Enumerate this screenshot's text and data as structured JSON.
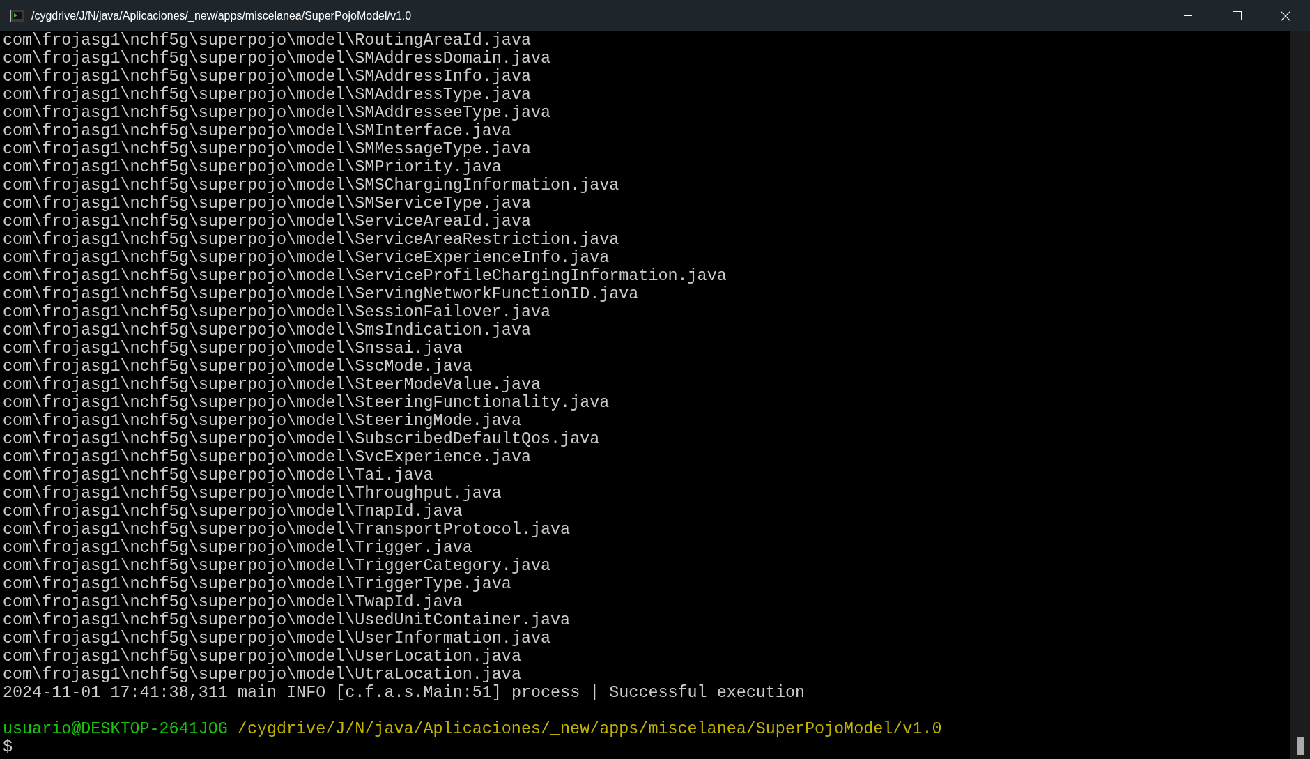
{
  "window": {
    "title": "/cygdrive/J/N/java/Aplicaciones/_new/apps/miscelanea/SuperPojoModel/v1.0"
  },
  "terminal": {
    "lines": [
      "com\\frojasg1\\nchf5g\\superpojo\\model\\RoutingAreaId.java",
      "com\\frojasg1\\nchf5g\\superpojo\\model\\SMAddressDomain.java",
      "com\\frojasg1\\nchf5g\\superpojo\\model\\SMAddressInfo.java",
      "com\\frojasg1\\nchf5g\\superpojo\\model\\SMAddressType.java",
      "com\\frojasg1\\nchf5g\\superpojo\\model\\SMAddresseeType.java",
      "com\\frojasg1\\nchf5g\\superpojo\\model\\SMInterface.java",
      "com\\frojasg1\\nchf5g\\superpojo\\model\\SMMessageType.java",
      "com\\frojasg1\\nchf5g\\superpojo\\model\\SMPriority.java",
      "com\\frojasg1\\nchf5g\\superpojo\\model\\SMSChargingInformation.java",
      "com\\frojasg1\\nchf5g\\superpojo\\model\\SMServiceType.java",
      "com\\frojasg1\\nchf5g\\superpojo\\model\\ServiceAreaId.java",
      "com\\frojasg1\\nchf5g\\superpojo\\model\\ServiceAreaRestriction.java",
      "com\\frojasg1\\nchf5g\\superpojo\\model\\ServiceExperienceInfo.java",
      "com\\frojasg1\\nchf5g\\superpojo\\model\\ServiceProfileChargingInformation.java",
      "com\\frojasg1\\nchf5g\\superpojo\\model\\ServingNetworkFunctionID.java",
      "com\\frojasg1\\nchf5g\\superpojo\\model\\SessionFailover.java",
      "com\\frojasg1\\nchf5g\\superpojo\\model\\SmsIndication.java",
      "com\\frojasg1\\nchf5g\\superpojo\\model\\Snssai.java",
      "com\\frojasg1\\nchf5g\\superpojo\\model\\SscMode.java",
      "com\\frojasg1\\nchf5g\\superpojo\\model\\SteerModeValue.java",
      "com\\frojasg1\\nchf5g\\superpojo\\model\\SteeringFunctionality.java",
      "com\\frojasg1\\nchf5g\\superpojo\\model\\SteeringMode.java",
      "com\\frojasg1\\nchf5g\\superpojo\\model\\SubscribedDefaultQos.java",
      "com\\frojasg1\\nchf5g\\superpojo\\model\\SvcExperience.java",
      "com\\frojasg1\\nchf5g\\superpojo\\model\\Tai.java",
      "com\\frojasg1\\nchf5g\\superpojo\\model\\Throughput.java",
      "com\\frojasg1\\nchf5g\\superpojo\\model\\TnapId.java",
      "com\\frojasg1\\nchf5g\\superpojo\\model\\TransportProtocol.java",
      "com\\frojasg1\\nchf5g\\superpojo\\model\\Trigger.java",
      "com\\frojasg1\\nchf5g\\superpojo\\model\\TriggerCategory.java",
      "com\\frojasg1\\nchf5g\\superpojo\\model\\TriggerType.java",
      "com\\frojasg1\\nchf5g\\superpojo\\model\\TwapId.java",
      "com\\frojasg1\\nchf5g\\superpojo\\model\\UsedUnitContainer.java",
      "com\\frojasg1\\nchf5g\\superpojo\\model\\UserInformation.java",
      "com\\frojasg1\\nchf5g\\superpojo\\model\\UserLocation.java",
      "com\\frojasg1\\nchf5g\\superpojo\\model\\UtraLocation.java",
      "2024-11-01 17:41:38,311 main INFO [c.f.a.s.Main:51] process | Successful execution"
    ],
    "prompt": {
      "user": "usuario@DESKTOP-2641JOG",
      "path": "/cygdrive/J/N/java/Aplicaciones/_new/apps/miscelanea/SuperPojoModel/v1.0",
      "symbol": "$"
    }
  }
}
